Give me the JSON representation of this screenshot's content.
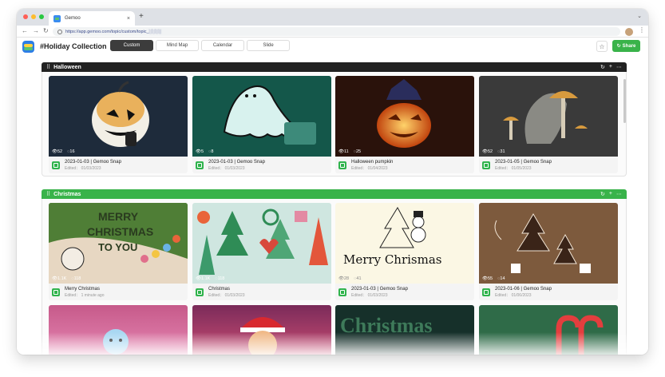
{
  "browser": {
    "tab_title": "Gemoo",
    "tab_close": "×",
    "new_tab": "+",
    "tab_menu": "⌄",
    "url": "https://app.gemoo.com/topic/custom/topic_░░░░",
    "dot_colors": [
      "#fe5f57",
      "#febc2e",
      "#28c840"
    ]
  },
  "app": {
    "title": "#Holiday Collection",
    "views": [
      "Custom",
      "Mind Map",
      "Calendar",
      "Slide"
    ],
    "active_view": "Custom",
    "share_label": "Share",
    "accent_color": "#39b34a"
  },
  "sections": [
    {
      "title": "Halloween",
      "bar_color": "#222222",
      "cards": [
        {
          "title": "2023-01-03 | Gemoo Snap",
          "edited": "Edited： 01/03/2023",
          "views": "52",
          "comments": "16",
          "image": "halloween-pumpkin-sketch"
        },
        {
          "title": "2023-01-03 | Gemoo Snap",
          "edited": "Edited： 01/03/2023",
          "views": "5",
          "comments": "8",
          "image": "ghost-illustration"
        },
        {
          "title": "Halloween pumpkin",
          "edited": "Edited： 01/04/2023",
          "views": "11",
          "comments": "25",
          "image": "jack-o-lantern-photo"
        },
        {
          "title": "2023-01-05 | Gemoo Snap",
          "edited": "Edited： 01/05/2023",
          "views": "52",
          "comments": "31",
          "image": "mushroom-illustration"
        }
      ]
    },
    {
      "title": "Christmas",
      "bar_color": "#39b34a",
      "cards": [
        {
          "title": "Merry Christmas",
          "edited": "Edited： 1 minute ago",
          "views": "1.1K",
          "comments": "118",
          "image": "merry-christmas-to-you",
          "thumb_text": [
            "MERRY",
            "CHRISTMAS",
            "TO YOU"
          ]
        },
        {
          "title": "Christmas",
          "edited": "Edited： 01/03/2023",
          "views": "1.1K",
          "comments": "118",
          "image": "christmas-trees-pattern"
        },
        {
          "title": "2023-01-03 | Gemoo Snap",
          "edited": "Edited： 01/03/2023",
          "views": "28",
          "comments": "41",
          "image": "merry-christmas-sketch",
          "thumb_text": [
            "Merry Chrismas"
          ]
        },
        {
          "title": "2023-01-06 | Gemoo Snap",
          "edited": "Edited： 01/06/2023",
          "views": "55",
          "comments": "14",
          "image": "christmas-trees-gifts"
        }
      ]
    }
  ],
  "third_row_thumbs": [
    "pink-cupcake",
    "santa-character",
    "christmas-3d-letters",
    "candy-canes"
  ],
  "third_row_text": [
    "Christmas"
  ]
}
